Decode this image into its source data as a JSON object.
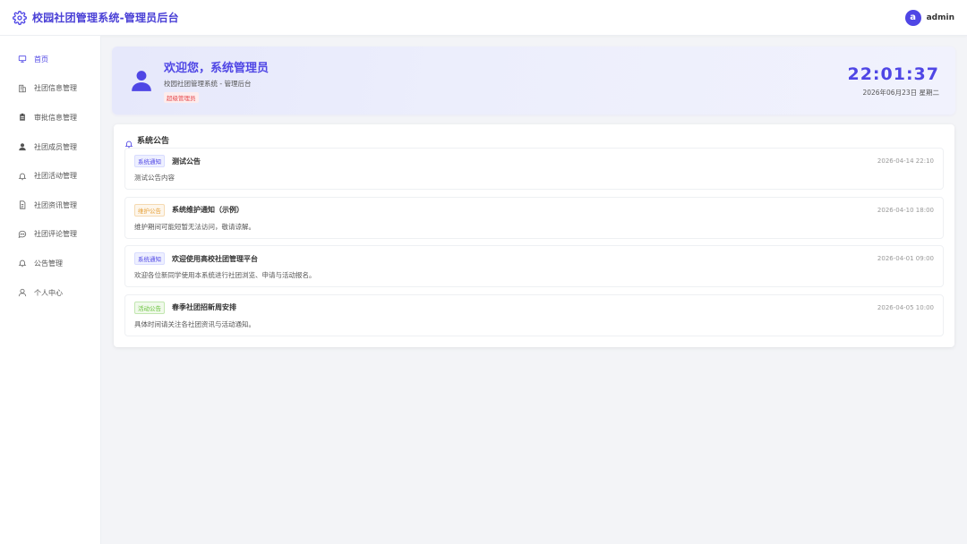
{
  "header": {
    "title": "校园社团管理系统-管理员后台",
    "avatar_letter": "a",
    "username": "admin"
  },
  "sidebar": {
    "items": [
      {
        "label": "首页",
        "icon": "home-icon",
        "active": true
      },
      {
        "label": "社团信息管理",
        "icon": "building-icon",
        "active": false
      },
      {
        "label": "审批信息管理",
        "icon": "clipboard-icon",
        "active": false
      },
      {
        "label": "社团成员管理",
        "icon": "user-icon",
        "active": false
      },
      {
        "label": "社团活动管理",
        "icon": "bell-icon",
        "active": false
      },
      {
        "label": "社团资讯管理",
        "icon": "document-icon",
        "active": false
      },
      {
        "label": "社团评论管理",
        "icon": "comment-icon",
        "active": false
      },
      {
        "label": "公告管理",
        "icon": "bell-icon",
        "active": false
      },
      {
        "label": "个人中心",
        "icon": "person-outline-icon",
        "active": false
      }
    ]
  },
  "welcome": {
    "title": "欢迎您，系统管理员",
    "subtitle": "校园社团管理系统 - 管理后台",
    "badge": "超级管理员",
    "time": "22:01:37",
    "date": "2026年06月23日 星期二"
  },
  "announcements": {
    "title": "系统公告",
    "items": [
      {
        "tag": "系统通知",
        "tag_type": "system",
        "title": "测试公告",
        "time": "2026-04-14 22:10",
        "content": "测试公告内容"
      },
      {
        "tag": "维护公告",
        "tag_type": "maint",
        "title": "系统维护通知（示例）",
        "time": "2026-04-10 18:00",
        "content": "维护期间可能短暂无法访问，敬请谅解。"
      },
      {
        "tag": "系统通知",
        "tag_type": "system",
        "title": "欢迎使用高校社团管理平台",
        "time": "2026-04-01 09:00",
        "content": "欢迎各位新同学使用本系统进行社团浏览、申请与活动报名。"
      },
      {
        "tag": "活动公告",
        "tag_type": "activity",
        "title": "春季社团招新周安排",
        "time": "2026-04-05 10:00",
        "content": "具体时间请关注各社团资讯与活动通知。"
      }
    ]
  },
  "colors": {
    "accent": "#4f46e5",
    "badge_red": "#e5484d"
  }
}
